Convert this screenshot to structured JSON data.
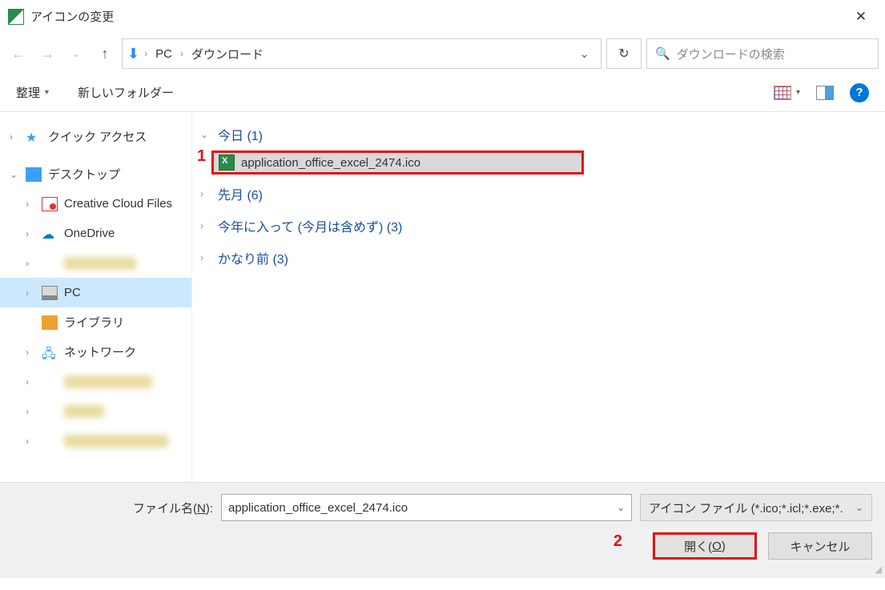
{
  "title": "アイコンの変更",
  "breadcrumb": {
    "items": [
      "PC",
      "ダウンロード"
    ]
  },
  "search": {
    "placeholder": "ダウンロードの検索"
  },
  "toolbar": {
    "organize": "整理",
    "newfolder": "新しいフォルダー"
  },
  "sidebar": {
    "quickaccess": "クイック アクセス",
    "desktop": "デスクトップ",
    "cc": "Creative Cloud Files",
    "onedrive": "OneDrive",
    "pc": "PC",
    "libraries": "ライブラリ",
    "network": "ネットワーク"
  },
  "groups": {
    "today": "今日 (1)",
    "lastmonth": "先月 (6)",
    "thisyear": "今年に入って (今月は含めず) (3)",
    "older": "かなり前 (3)"
  },
  "file": {
    "name": "application_office_excel_2474.ico"
  },
  "annotations": {
    "one": "1",
    "two": "2"
  },
  "footer": {
    "label_pre": "ファイル名(",
    "label_u": "N",
    "label_post": "):",
    "filename": "application_office_excel_2474.ico",
    "filetype": "アイコン ファイル (*.ico;*.icl;*.exe;*.",
    "open_pre": "開く(",
    "open_u": "O",
    "open_post": ")",
    "cancel": "キャンセル"
  }
}
